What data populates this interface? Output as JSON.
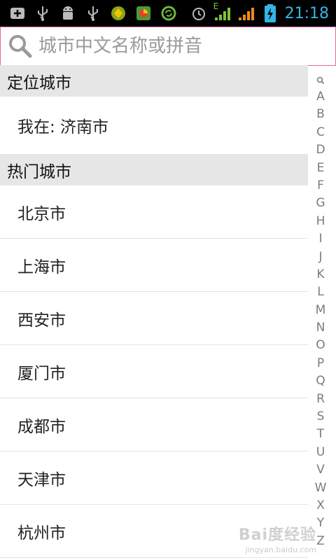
{
  "status_bar": {
    "time": "21:18",
    "network_label": "E",
    "icons": [
      "add-icon",
      "usb-icon",
      "android-debug-icon",
      "usb-icon",
      "app-icon",
      "gallery-icon",
      "sync-icon",
      "alarm-icon",
      "signal-icon",
      "signal-icon",
      "battery-charging-icon"
    ],
    "accent_color": "#33b5e5"
  },
  "search": {
    "placeholder": "城市中文名称或拼音",
    "value": ""
  },
  "sections": [
    {
      "title": "定位城市",
      "items": [
        "我在: 济南市"
      ]
    },
    {
      "title": "热门城市",
      "items": [
        "北京市",
        "上海市",
        "西安市",
        "厦门市",
        "成都市",
        "天津市",
        "杭州市"
      ]
    }
  ],
  "index_bar": {
    "letters": [
      "A",
      "B",
      "C",
      "D",
      "E",
      "F",
      "G",
      "H",
      "I",
      "J",
      "K",
      "L",
      "M",
      "N",
      "O",
      "P",
      "Q",
      "R",
      "S",
      "T",
      "U",
      "V",
      "W",
      "X",
      "Y",
      "Z"
    ]
  },
  "watermark": {
    "text": "Bai度经验",
    "sub": "jingyan.baidu.com"
  }
}
